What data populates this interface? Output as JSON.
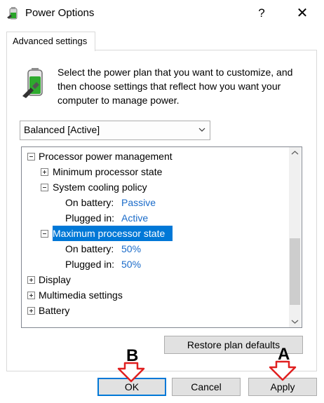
{
  "window": {
    "title": "Power Options",
    "help_label": "?",
    "close_label": "✕"
  },
  "tab": {
    "label": "Advanced settings"
  },
  "description": "Select the power plan that you want to customize, and then choose settings that reflect how you want your computer to manage power.",
  "plan_select": {
    "value": "Balanced [Active]"
  },
  "tree": {
    "processor": "Processor power management",
    "min_state": "Minimum processor state",
    "cooling": "System cooling policy",
    "cooling_battery_label": "On battery:",
    "cooling_battery_value": "Passive",
    "cooling_plugged_label": "Plugged in:",
    "cooling_plugged_value": "Active",
    "max_state": "Maximum processor state",
    "max_battery_label": "On battery:",
    "max_battery_value": "50%",
    "max_plugged_label": "Plugged in:",
    "max_plugged_value": "50%",
    "display": "Display",
    "multimedia": "Multimedia settings",
    "battery": "Battery"
  },
  "buttons": {
    "restore": "Restore plan defaults",
    "ok": "OK",
    "cancel": "Cancel",
    "apply": "Apply"
  },
  "markers": {
    "a": "A",
    "b": "B"
  },
  "colors": {
    "accent": "#0078d7",
    "link_value": "#1a6bc9",
    "marker": "#e02020"
  }
}
